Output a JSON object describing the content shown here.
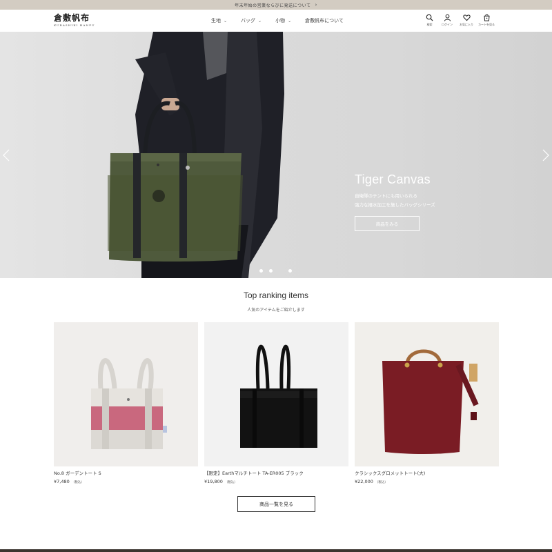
{
  "announcement": {
    "text": "年末年始の営業ならびに発送について",
    "chevron": "›"
  },
  "header": {
    "logo_jp": "倉敷帆布",
    "logo_en": "KURASHIKI HANPU",
    "nav": [
      {
        "label": "生地",
        "has_caret": true
      },
      {
        "label": "バッグ",
        "has_caret": true
      },
      {
        "label": "小物",
        "has_caret": true
      },
      {
        "label": "倉敷帆布について",
        "has_caret": false
      }
    ],
    "tools": [
      {
        "icon": "search-icon",
        "label": "検索"
      },
      {
        "icon": "user-icon",
        "label": "ログイン"
      },
      {
        "icon": "heart-icon",
        "label": "お気に入り"
      },
      {
        "icon": "cart-icon",
        "label": "カートを見る"
      }
    ]
  },
  "hero": {
    "title": "Tiger Canvas",
    "subtitle_line1": "自衛隊のテントにも用いられる",
    "subtitle_line2": "強力な撥水加工を施したバッグシリーズ",
    "button_label": "商品をみる",
    "slide_count": 3,
    "active_slide": 3
  },
  "ranking": {
    "title": "Top ranking items",
    "subtitle": "人気のアイテムをご紹介します",
    "items": [
      {
        "name": "No.8 ガーデントート S",
        "price": "¥7,480",
        "tax": "（税込）"
      },
      {
        "name": "【限定】Earthマルチトート TA-ER005 ブラック",
        "price": "¥19,800",
        "tax": "（税込）"
      },
      {
        "name": "クラシックスグロメットトート(大)",
        "price": "¥22,000",
        "tax": "（税込）"
      }
    ],
    "view_all_label": "商品一覧を見る"
  },
  "colors": {
    "announce_bg": "#d3ccc2",
    "hero_text": "#ffffff",
    "olive_bag": "#4f5a3c",
    "burgundy_bag": "#7a1c24",
    "pink_stripe": "#c9687e"
  }
}
